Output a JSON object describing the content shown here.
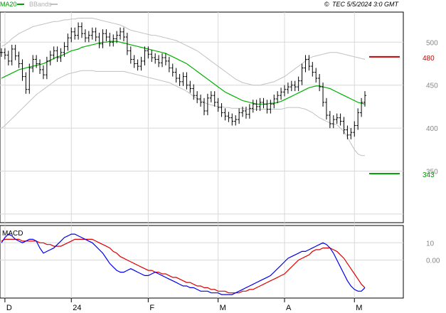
{
  "header": {
    "legend": [
      {
        "name": "MA20",
        "color": "#00a000"
      },
      {
        "name": "BBands",
        "color": "#b0b0b0"
      }
    ],
    "copyright_symbol": "©",
    "timestamp": "TEC 5/5/2024 3:0 GMT"
  },
  "colors": {
    "price_bar": "#000000",
    "ma20": "#00b000",
    "bbands": "#c0c0c0",
    "resistance": "#cc0000",
    "support": "#009900",
    "macd_line": "#0000ee",
    "macd_signal": "#dd0000",
    "grid": "#d8d8d8",
    "plot_bg": "#ffffff"
  },
  "chart_data": [
    {
      "type": "ohlc",
      "title": "",
      "xlabel": "",
      "ylabel": "",
      "ylim": [
        290,
        535
      ],
      "yticks": [
        350,
        400,
        450,
        500
      ],
      "xticks": [
        {
          "label": "D",
          "index": 1
        },
        {
          "label": "24",
          "index": 20
        },
        {
          "label": "F",
          "index": 42
        },
        {
          "label": "M",
          "index": 62
        },
        {
          "label": "A",
          "index": 81
        },
        {
          "label": "M",
          "index": 101
        }
      ],
      "levels": [
        {
          "label": "480",
          "value": 483,
          "role": "resistance"
        },
        {
          "label": "343",
          "value": 347,
          "role": "support"
        }
      ],
      "close": [
        488,
        485,
        478,
        492,
        484,
        475,
        460,
        445,
        470,
        480,
        475,
        468,
        462,
        478,
        485,
        490,
        482,
        488,
        495,
        505,
        512,
        508,
        518,
        510,
        505,
        508,
        512,
        506,
        498,
        510,
        506,
        500,
        504,
        508,
        512,
        506,
        490,
        480,
        475,
        472,
        478,
        490,
        486,
        482,
        480,
        476,
        482,
        478,
        470,
        465,
        458,
        454,
        460,
        450,
        446,
        438,
        434,
        430,
        420,
        435,
        438,
        430,
        424,
        418,
        414,
        412,
        408,
        410,
        418,
        420,
        416,
        423,
        428,
        425,
        430,
        428,
        422,
        428,
        434,
        438,
        442,
        445,
        448,
        450,
        448,
        455,
        470,
        480,
        472,
        465,
        458,
        448,
        430,
        415,
        405,
        410,
        412,
        408,
        398,
        392,
        395,
        403,
        418,
        430,
        438
      ],
      "series": [
        {
          "name": "MA20",
          "values": [
            458,
            460,
            462,
            464,
            466,
            468,
            469,
            470,
            471,
            472,
            473,
            474,
            475,
            477,
            479,
            481,
            483,
            484,
            486,
            488,
            490,
            491,
            492,
            494,
            495,
            496,
            497,
            498,
            499,
            500,
            500,
            501,
            501,
            501,
            500,
            499,
            498,
            497,
            496,
            495,
            494,
            493,
            492,
            491,
            490,
            489,
            488,
            487,
            485,
            483,
            481,
            479,
            477,
            475,
            472,
            469,
            466,
            463,
            460,
            457,
            454,
            451,
            448,
            445,
            442,
            440,
            438,
            436,
            434,
            432,
            431,
            430,
            429,
            428,
            428,
            428,
            428,
            429,
            429,
            430,
            431,
            433,
            435,
            437,
            439,
            441,
            443,
            445,
            447,
            448,
            449,
            449,
            448,
            447,
            446,
            444,
            442,
            440,
            438,
            436,
            434,
            432,
            430,
            429,
            428
          ]
        },
        {
          "name": "BBands upper",
          "values": [
            495,
            497,
            500,
            504,
            507,
            510,
            512,
            514,
            516,
            518,
            519,
            520,
            521,
            522,
            523,
            524,
            524,
            525,
            526,
            526,
            527,
            527,
            528,
            528,
            528,
            528,
            528,
            527,
            526,
            525,
            524,
            523,
            522,
            521,
            520,
            518,
            516,
            514,
            513,
            512,
            511,
            510,
            509,
            508,
            508,
            507,
            506,
            505,
            504,
            503,
            502,
            500,
            498,
            496,
            494,
            492,
            490,
            487,
            484,
            481,
            478,
            475,
            472,
            469,
            466,
            463,
            460,
            457,
            455,
            453,
            452,
            451,
            450,
            450,
            450,
            451,
            452,
            453,
            454,
            456,
            458,
            460,
            463,
            466,
            469,
            472,
            475,
            478,
            481,
            483,
            484,
            485,
            486,
            487,
            488,
            488,
            488,
            487,
            486,
            485,
            484,
            483,
            482,
            481,
            480
          ]
        },
        {
          "name": "BBands lower",
          "values": [
            400,
            403,
            407,
            411,
            415,
            419,
            423,
            427,
            431,
            435,
            439,
            442,
            445,
            448,
            451,
            454,
            457,
            459,
            461,
            463,
            464,
            465,
            466,
            467,
            467,
            467,
            467,
            466,
            466,
            466,
            466,
            466,
            466,
            466,
            466,
            466,
            465,
            464,
            463,
            462,
            461,
            460,
            459,
            458,
            457,
            456,
            455,
            454,
            453,
            451,
            449,
            447,
            445,
            443,
            440,
            437,
            434,
            432,
            430,
            428,
            427,
            426,
            425,
            425,
            424,
            424,
            423,
            423,
            423,
            423,
            422,
            422,
            422,
            422,
            422,
            422,
            422,
            422,
            422,
            422,
            422,
            423,
            424,
            424,
            424,
            424,
            423,
            422,
            420,
            418,
            415,
            412,
            410,
            408,
            406,
            405,
            404,
            400,
            396,
            390,
            382,
            375,
            370,
            368,
            368
          ]
        }
      ]
    },
    {
      "type": "line",
      "title": "MACD",
      "xlabel": "",
      "ylabel": "",
      "ylim": [
        -22,
        20
      ],
      "yticks": [
        {
          "label": "10",
          "value": 10
        },
        {
          "label": "0.00",
          "value": 0
        }
      ],
      "series": [
        {
          "name": "",
          "values": [
            10,
            13,
            15,
            14,
            12,
            11,
            10,
            11,
            12,
            12,
            11,
            7,
            4,
            5,
            6,
            7,
            9,
            11,
            13,
            14,
            15,
            15,
            14,
            13,
            12,
            11,
            10,
            8,
            6,
            4,
            1,
            -2,
            -4,
            -6,
            -7,
            -7,
            -6,
            -5,
            -6,
            -7,
            -8,
            -9,
            -9,
            -8,
            -7,
            -8,
            -9,
            -10,
            -11,
            -12,
            -13,
            -14,
            -15,
            -15,
            -16,
            -16,
            -17,
            -18,
            -18,
            -18,
            -19,
            -19,
            -19,
            -20,
            -20,
            -20,
            -20,
            -19,
            -18,
            -17,
            -16,
            -15,
            -14,
            -13,
            -12,
            -11,
            -10,
            -9,
            -7,
            -5,
            -3,
            -1,
            1,
            2,
            3,
            4,
            5,
            5,
            6,
            7,
            8,
            9,
            10,
            9,
            7,
            4,
            0,
            -4,
            -8,
            -12,
            -15,
            -17,
            -18,
            -18,
            -16
          ]
        },
        {
          "name": "",
          "values": [
            11,
            12,
            12,
            12,
            12,
            12,
            11,
            11,
            11,
            11,
            11,
            10,
            10,
            9,
            9,
            8,
            8,
            8,
            9,
            10,
            11,
            12,
            12,
            12,
            12,
            12,
            12,
            11,
            10,
            9,
            8,
            7,
            5,
            4,
            2,
            1,
            0,
            -1,
            -2,
            -3,
            -4,
            -5,
            -6,
            -6,
            -7,
            -7,
            -8,
            -8,
            -9,
            -10,
            -10,
            -11,
            -12,
            -13,
            -13,
            -14,
            -15,
            -15,
            -16,
            -16,
            -17,
            -17,
            -18,
            -18,
            -18,
            -19,
            -19,
            -19,
            -19,
            -18,
            -18,
            -17,
            -17,
            -16,
            -15,
            -14,
            -13,
            -12,
            -11,
            -10,
            -9,
            -8,
            -6,
            -4,
            -2,
            0,
            1,
            2,
            3,
            5,
            6,
            6,
            7,
            7,
            7,
            6,
            5,
            3,
            1,
            -2,
            -5,
            -8,
            -11,
            -14,
            -16
          ]
        }
      ]
    }
  ]
}
